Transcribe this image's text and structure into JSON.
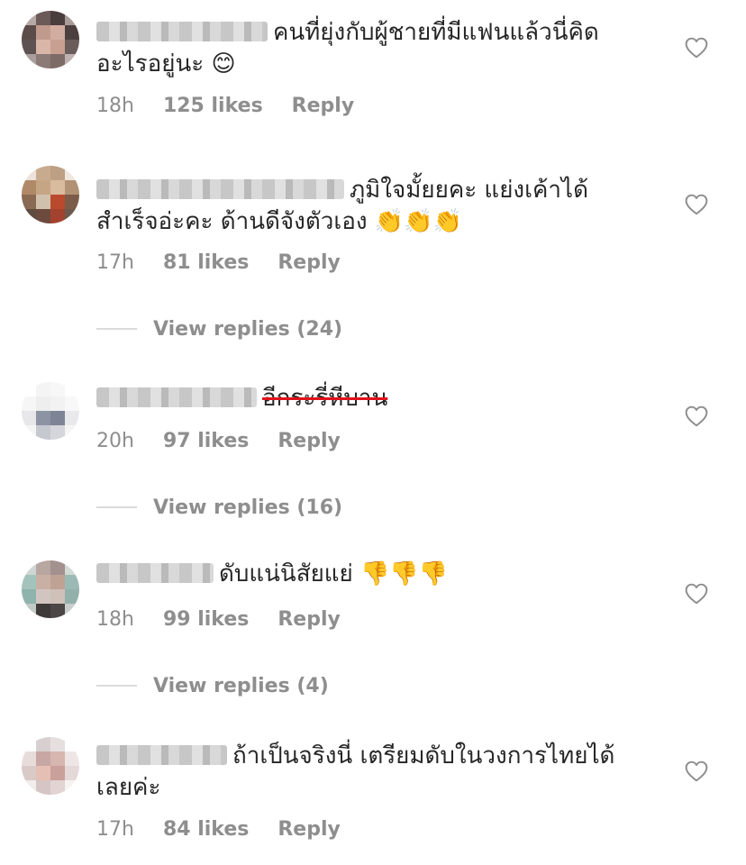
{
  "comments": [
    {
      "text": "คนที่ยุ่งกับผู้ชายที่มีแฟนแล้วนี่คิดอะไรอยู่นะ",
      "emoji": "😊",
      "time": "18h",
      "likes": "125 likes",
      "reply": "Reply",
      "icon": "heart-outline-icon"
    },
    {
      "text": "ภูมิใจมั้ยยคะ แย่งเค้าได้สำเร็จอ่ะคะ ด้านดีจังตัวเอง",
      "emoji": "👏👏👏",
      "time": "17h",
      "likes": "81 likes",
      "reply": "Reply",
      "view_replies": "View replies (24)",
      "icon": "heart-outline-icon"
    },
    {
      "text": "อีกระรี่หีบาน",
      "time": "20h",
      "likes": "97 likes",
      "reply": "Reply",
      "view_replies": "View replies (16)",
      "icon": "heart-outline-icon"
    },
    {
      "text": "ดับแน่นิสัยแย่",
      "emoji": "👎👎👎",
      "time": "18h",
      "likes": "99 likes",
      "reply": "Reply",
      "view_replies": "View replies (4)",
      "icon": "heart-outline-icon"
    },
    {
      "text": "ถ้าเป็นจริงนี่ เตรียมดับในวงการไทยได้เลยค่ะ",
      "time": "17h",
      "likes": "84 likes",
      "reply": "Reply",
      "icon": "heart-outline-icon"
    }
  ],
  "colors": {
    "text": "#262626",
    "meta": "#8e8e8e",
    "strike": "#e0121b",
    "divider": "#dbdbdb"
  }
}
